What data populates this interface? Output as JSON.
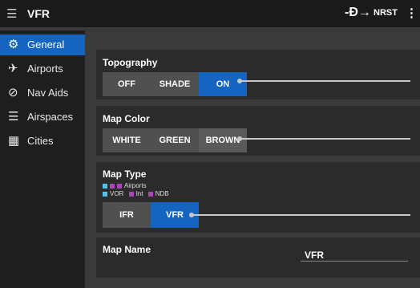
{
  "topbar": {
    "title": "VFR",
    "nrst_label": "NRST"
  },
  "sidebar": {
    "items": [
      {
        "label": "General",
        "icon": "gear-icon"
      },
      {
        "label": "Airports",
        "icon": "airport-icon"
      },
      {
        "label": "Nav Aids",
        "icon": "compass-icon"
      },
      {
        "label": "Airspaces",
        "icon": "airspace-icon"
      },
      {
        "label": "Cities",
        "icon": "city-icon"
      }
    ]
  },
  "topography": {
    "title": "Topography",
    "options": [
      "OFF",
      "SHADE",
      "ON"
    ],
    "selected": "ON"
  },
  "map_color": {
    "title": "Map Color",
    "options": [
      "WHITE",
      "GREEN",
      "BROWN"
    ],
    "selected": "BROWN"
  },
  "map_type": {
    "title": "Map Type",
    "legend_airports": "Airports",
    "legend_vor": "VOR",
    "legend_int": "Int",
    "legend_ndb": "NDB",
    "options": [
      "IFR",
      "VFR"
    ],
    "selected": "VFR"
  },
  "map_name": {
    "title": "Map Name",
    "value": "VFR"
  },
  "colors": {
    "accent": "#1565c0",
    "airports_legend": [
      "#4fc3f7",
      "#ab47bc",
      "#ab47bc"
    ],
    "vor": "#4fc3f7",
    "int": "#ab47bc",
    "ndb": "#ab47bc"
  }
}
